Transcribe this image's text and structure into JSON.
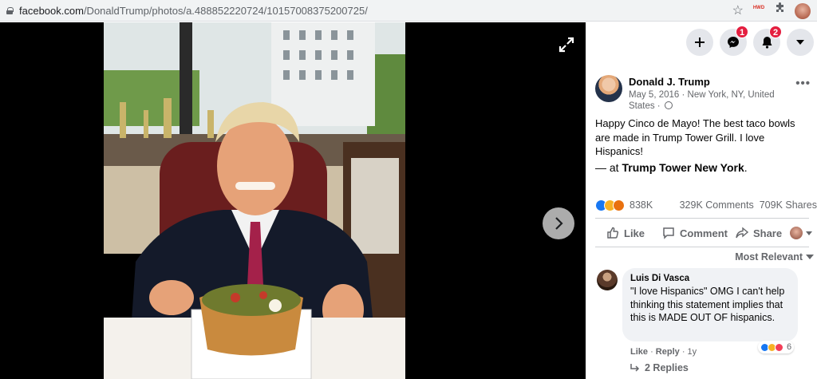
{
  "browser": {
    "url_host": "facebook.com",
    "url_path": "/DonaldTrump/photos/a.488852220724/10157008375200725/",
    "extension_label": "HWD"
  },
  "panel": {
    "create_icon": "plus-icon",
    "messenger": {
      "icon": "messenger-icon",
      "badge": "1"
    },
    "notifications": {
      "icon": "bell-icon",
      "badge": "2"
    },
    "account_icon": "caret-down-icon"
  },
  "post": {
    "author": "Donald J. Trump",
    "meta": "May 5, 2016 · New York, NY, United States ·",
    "text": "Happy Cinco de Mayo! The best taco bowls are made in Trump Tower Grill. I love Hispanics!",
    "at_prefix": "— at",
    "at_place": "Trump Tower New York",
    "at_suffix": ".",
    "reaction_count": "838K",
    "comments_count": "329K Comments",
    "shares_count": "709K Shares",
    "actions": {
      "like": "Like",
      "comment": "Comment",
      "share": "Share"
    },
    "sort_label": "Most Relevant"
  },
  "comment": {
    "name": "Luis Di Vasca",
    "text": "\"I love Hispanics\" OMG I can't help thinking this statement implies that this is MADE OUT OF hispanics.",
    "reaction_count": "6",
    "like": "Like",
    "reply": "Reply",
    "age": "1y",
    "replies_label": "2 Replies"
  },
  "colors": {
    "accent": "#1877f2",
    "badge": "#e41e3f",
    "secondary_text": "#65676b"
  }
}
